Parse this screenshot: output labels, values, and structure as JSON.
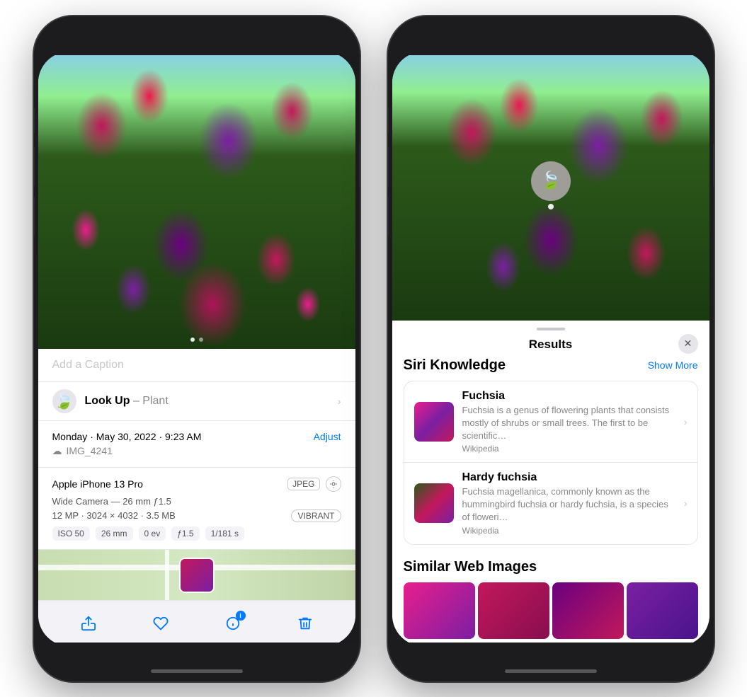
{
  "phone1": {
    "caption_placeholder": "Add a Caption",
    "lookup_label": "Look Up",
    "lookup_type": "Plant",
    "date": "Monday · May 30, 2022 · 9:23 AM",
    "adjust_btn": "Adjust",
    "filename": "IMG_4241",
    "device": "Apple iPhone 13 Pro",
    "format_badge": "JPEG",
    "camera_type": "Wide Camera — 26 mm ƒ1.5",
    "resolution": "12 MP · 3024 × 4032 · 3.5 MB",
    "style_badge": "VIBRANT",
    "exif": {
      "iso": "ISO 50",
      "focal": "26 mm",
      "ev": "0 ev",
      "aperture": "ƒ1.5",
      "shutter": "1/181 s"
    },
    "toolbar": {
      "share": "↑",
      "favorite": "♡",
      "info": "ℹ",
      "delete": "🗑"
    }
  },
  "phone2": {
    "results_title": "Results",
    "close_btn": "✕",
    "siri_section_title": "Siri Knowledge",
    "show_more": "Show More",
    "items": [
      {
        "name": "Fuchsia",
        "description": "Fuchsia is a genus of flowering plants that consists mostly of shrubs or small trees. The first to be scientific…",
        "source": "Wikipedia"
      },
      {
        "name": "Hardy fuchsia",
        "description": "Fuchsia magellanica, commonly known as the hummingbird fuchsia or hardy fuchsia, is a species of floweri…",
        "source": "Wikipedia"
      }
    ],
    "similar_title": "Similar Web Images"
  }
}
